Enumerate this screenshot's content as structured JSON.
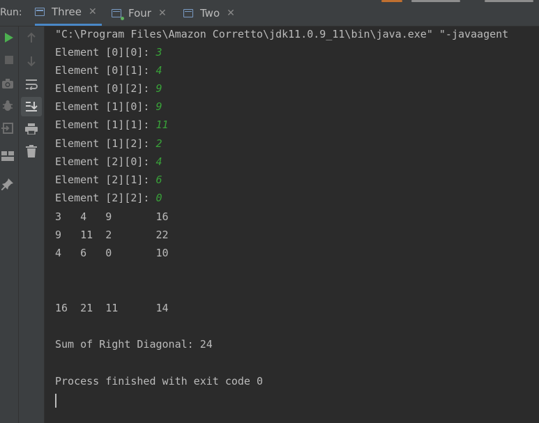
{
  "run_panel": {
    "label": "Run:",
    "tabs": [
      {
        "label": "Three",
        "close": "✕"
      },
      {
        "label": "Four",
        "close": "✕"
      },
      {
        "label": "Two",
        "close": "✕"
      }
    ]
  },
  "colors": {
    "background": "#2b2b2b",
    "toolbar": "#3c3f41",
    "output_text": "#bbbbbb",
    "input_text": "#39a139",
    "active_tab_underline": "#4a88c7",
    "run_icon": "#4caf50"
  },
  "toolbar_icons": [
    "run-icon",
    "stop-icon",
    "camera-icon",
    "bug-icon",
    "exit-icon",
    "layout-icon",
    "pin-icon",
    "up-arrow-icon",
    "down-arrow-icon",
    "soft-wrap-icon",
    "scroll-to-end-icon",
    "print-icon",
    "trash-icon"
  ],
  "console": {
    "command_line": "\"C:\\Program Files\\Amazon Corretto\\jdk11.0.9_11\\bin\\java.exe\" \"-javaagent",
    "prompts": [
      {
        "text": "Element [0][0]: ",
        "input": "3"
      },
      {
        "text": "Element [0][1]: ",
        "input": "4"
      },
      {
        "text": "Element [0][2]: ",
        "input": "9"
      },
      {
        "text": "Element [1][0]: ",
        "input": "9"
      },
      {
        "text": "Element [1][1]: ",
        "input": "11"
      },
      {
        "text": "Element [1][2]: ",
        "input": "2"
      },
      {
        "text": "Element [2][0]: ",
        "input": "4"
      },
      {
        "text": "Element [2][1]: ",
        "input": "6"
      },
      {
        "text": "Element [2][2]: ",
        "input": "0"
      }
    ],
    "matrix_rows": [
      "3   4   9       16",
      "9   11  2       22",
      "4   6   0       10"
    ],
    "column_sums": "16  21  11      14",
    "diagonal": "Sum of Right Diagonal: 24",
    "exit_message": "Process finished with exit code 0"
  }
}
